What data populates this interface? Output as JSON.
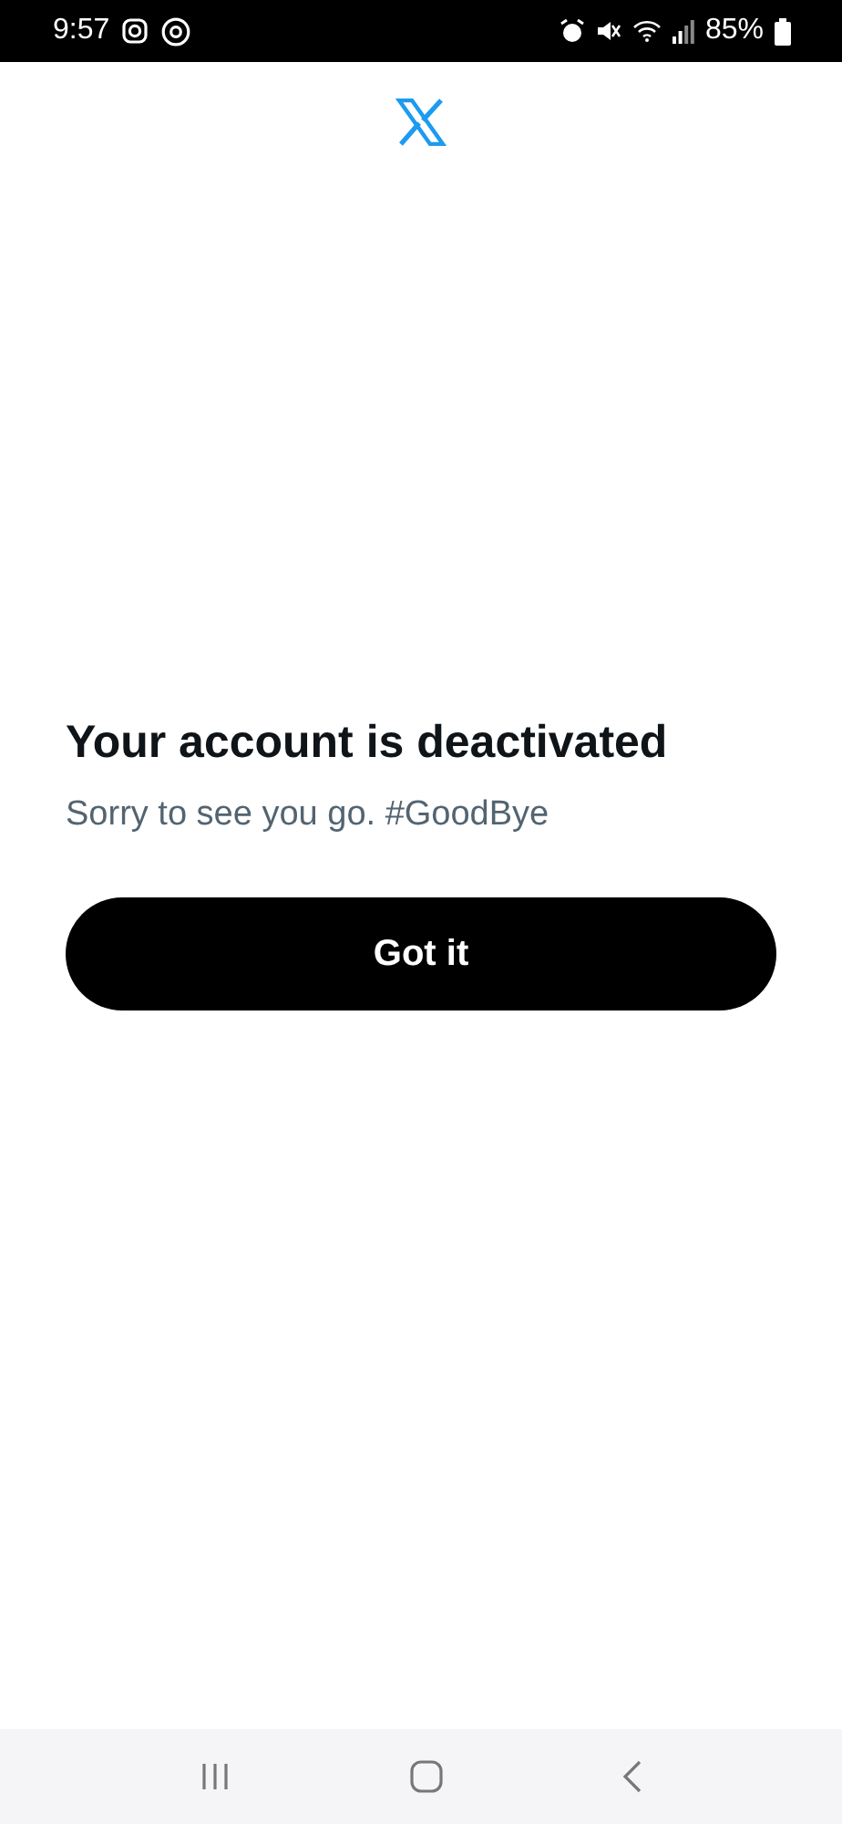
{
  "status_bar": {
    "time": "9:57",
    "battery": "85%"
  },
  "dialog": {
    "title": "Your account is deactivated",
    "message": "Sorry to see you go. #GoodBye",
    "button": "Got it"
  }
}
